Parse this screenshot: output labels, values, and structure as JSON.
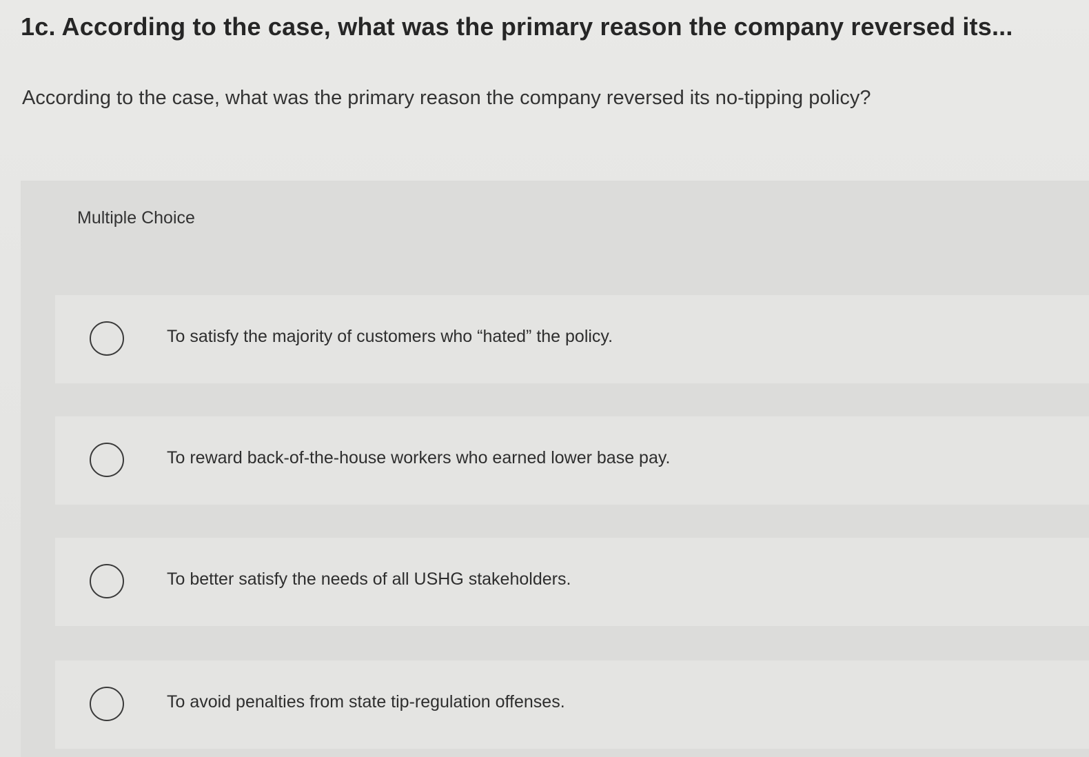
{
  "question": {
    "title": "1c. According to the case, what was the primary reason the company reversed its...",
    "prompt": "According to the case, what was the primary reason the company reversed its no-tipping policy?"
  },
  "multiple_choice": {
    "label": "Multiple Choice",
    "options": [
      {
        "text": "To satisfy the majority of customers who “hated” the policy.",
        "selected": false
      },
      {
        "text": "To reward back-of-the-house workers who earned lower base pay.",
        "selected": false
      },
      {
        "text": "To better satisfy the needs of all USHG stakeholders.",
        "selected": false
      },
      {
        "text": "To avoid penalties from state tip-regulation offenses.",
        "selected": false
      }
    ]
  }
}
